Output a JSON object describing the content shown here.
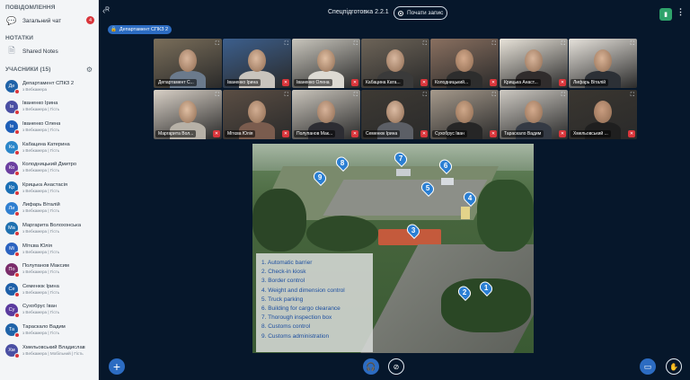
{
  "sidebar": {
    "messages_title": "ПОВІДОМЛЕННЯ",
    "public_chat": {
      "label": "Загальний чат",
      "unread": "4"
    },
    "notes_title": "НОТАТКИ",
    "shared_notes": "Shared Notes",
    "participants_title": "УЧАСНИКИ (15)",
    "participants": [
      {
        "initials": "Де",
        "name": "Департамент СПКЗ 2",
        "status": "з Вебкамера",
        "color": "#1f63a8"
      },
      {
        "initials": "Ів",
        "name": "Іваненко Ірина",
        "status": "з Вебкамера | Гість",
        "color": "#4a4fa3"
      },
      {
        "initials": "Ів",
        "name": "Іваненко Олена",
        "status": "з Вебкамера | Гість",
        "color": "#1e5fb8"
      },
      {
        "initials": "Ка",
        "name": "Кабацина Катерина",
        "status": "з Вебкамера | Гість",
        "color": "#2b86c9"
      },
      {
        "initials": "Ко",
        "name": "Колодницький Дмитро",
        "status": "з Вебкамера | Гість",
        "color": "#6b3fa0"
      },
      {
        "initials": "Кр",
        "name": "Крицька Анастасія",
        "status": "з Вебкамера | Гість",
        "color": "#1a6fb5"
      },
      {
        "initials": "Ли",
        "name": "Лифарь Віталій",
        "status": "з Вебкамера | Гість",
        "color": "#2f7fd0"
      },
      {
        "initials": "Ма",
        "name": "Маргарита Волохонська",
        "status": "з Вебкамера | Гість",
        "color": "#1f70b0"
      },
      {
        "initials": "Мі",
        "name": "Мітєва Юлія",
        "status": "з Вебкамера | Гість",
        "color": "#2a62c0"
      },
      {
        "initials": "По",
        "name": "Полупанов Максим",
        "status": "з Вебкамера | Гість",
        "color": "#7a2c6a"
      },
      {
        "initials": "Се",
        "name": "Семенюк Ірина",
        "status": "з Вебкамера | Гість",
        "color": "#1d5fa8"
      },
      {
        "initials": "Су",
        "name": "Сухобрус Іван",
        "status": "з Вебкамера | Гість",
        "color": "#5a3a9e"
      },
      {
        "initials": "Та",
        "name": "Тараскало Вадим",
        "status": "з Вебкамера | Гість",
        "color": "#1f63a8"
      },
      {
        "initials": "Хм",
        "name": "Хмельовський Владислав",
        "status": "з Вебкамера | Мобільний | Гість",
        "color": "#4a4fa3"
      }
    ]
  },
  "topbar": {
    "title": "Спецпідготовка 2.2.1",
    "record_label": "Почати запис"
  },
  "presenter": "Департамент СПКЗ 2",
  "videos": [
    {
      "name": "Департамент С...",
      "bg": "#7a6e5a",
      "skin": "#d8b59b",
      "shirt": "#6b7a8c",
      "muted": false
    },
    {
      "name": "Іваненко Ірина",
      "bg": "#3c5f8d",
      "skin": "#dcbaa0",
      "shirt": "#c9c4bd",
      "muted": true
    },
    {
      "name": "Іваненко Олена",
      "bg": "#c9c6bd",
      "skin": "#e0bfa3",
      "shirt": "#dddad3",
      "muted": true
    },
    {
      "name": "Кабацина Ката...",
      "bg": "#6d6458",
      "skin": "#d8b8a0",
      "shirt": "#3a3a3a",
      "muted": true
    },
    {
      "name": "Колодницький...",
      "bg": "#8a7060",
      "skin": "#d3a98b",
      "shirt": "#2d2d2d",
      "muted": true
    },
    {
      "name": "Крицька Анаст...",
      "bg": "#e9e4da",
      "skin": "#d8b59b",
      "shirt": "#302c2c",
      "muted": true
    },
    {
      "name": "Лифарь Віталій",
      "bg": "#e7e3dc",
      "skin": "#d9b396",
      "shirt": "#2c3036",
      "muted": false
    },
    {
      "name": "Маргарита Вол...",
      "bg": "#d8d0c6",
      "skin": "#e0bfa3",
      "shirt": "#b7b1a7",
      "muted": true
    },
    {
      "name": "Мітєва Юлія",
      "bg": "#5b4e44",
      "skin": "#d2ae93",
      "shirt": "#7a5c4e",
      "muted": true
    },
    {
      "name": "Полупанов Мак...",
      "bg": "#c9c4bb",
      "skin": "#d7b39a",
      "shirt": "#2d2d33",
      "muted": true
    },
    {
      "name": "Семенюк Ірина",
      "bg": "#3e3a34",
      "skin": "#dcbca4",
      "shirt": "#5c5f66",
      "muted": true
    },
    {
      "name": "Сухобрус Іван",
      "bg": "#a69a8c",
      "skin": "#cfa88a",
      "shirt": "#262626",
      "muted": true
    },
    {
      "name": "Тараскало Вадим",
      "bg": "#cdc9c2",
      "skin": "#d4ab8e",
      "shirt": "#343a44",
      "muted": true
    },
    {
      "name": "Хмельовський ...",
      "bg": "#3a3630",
      "skin": "#c99d80",
      "shirt": "#1f1f1f",
      "muted": true
    }
  ],
  "slide": {
    "legend": [
      "1.  Automatic barrier",
      "2.  Check-in kiosk",
      "3.  Border control",
      "4.  Weight and dimension control",
      "5.  Truck parking",
      "6.  Building for cargo clearance",
      "7.  Thorough inspection box",
      "8.  Customs control",
      "9.  Customs administration"
    ],
    "markers": [
      "1",
      "2",
      "3",
      "4",
      "5",
      "6",
      "7",
      "8",
      "9"
    ]
  },
  "colors": {
    "accent": "#2c6cc2",
    "alert": "#d9353b",
    "background": "#06172b"
  }
}
